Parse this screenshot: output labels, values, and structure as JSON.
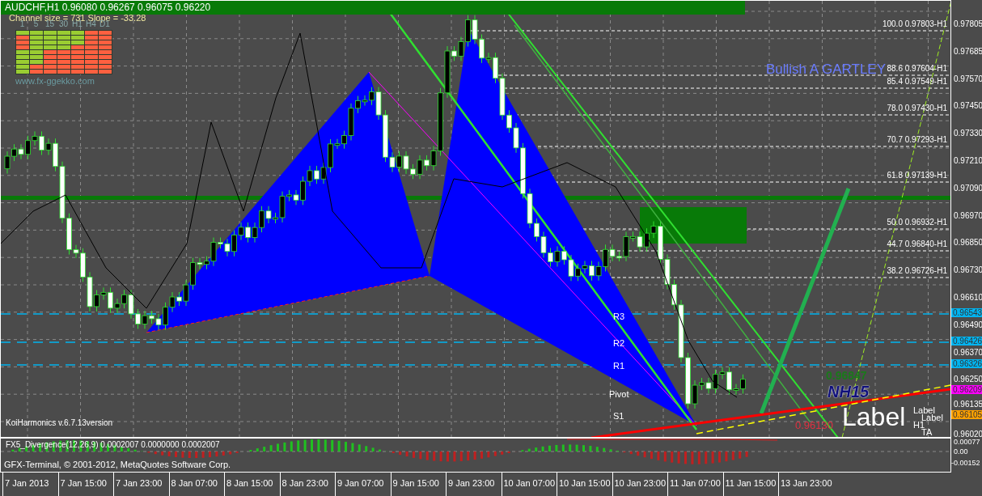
{
  "chart": {
    "header": "AUDCHF,H1  0.96080 0.96267 0.96075 0.96220",
    "channel_info": "Channel size = 731 Slope = -33.28",
    "timeframe_panel": {
      "columns": [
        {
          "label": "1",
          "cells": [
            {
              "color": "#9acd32"
            },
            {
              "color": "#ff6040"
            },
            {
              "color": "#ff6040"
            },
            {
              "color": "#ff6040"
            },
            {
              "color": "#9acd32"
            },
            {
              "color": "#9acd32"
            },
            {
              "color": "#9acd32"
            },
            {
              "color": "#9acd32"
            },
            {
              "color": "#9acd32"
            }
          ]
        },
        {
          "label": "5",
          "cells": [
            {
              "color": "#9acd32"
            },
            {
              "color": "#9acd32"
            },
            {
              "color": "#9acd32"
            },
            {
              "color": "#9acd32"
            },
            {
              "color": "#9acd32"
            },
            {
              "color": "#9acd32"
            },
            {
              "color": "#9acd32"
            },
            {
              "color": "#ff6040"
            },
            {
              "color": "#ff6040"
            }
          ]
        },
        {
          "label": "15",
          "cells": [
            {
              "color": "#9acd32"
            },
            {
              "color": "#9acd32"
            },
            {
              "color": "#9acd32"
            },
            {
              "color": "#9acd32"
            },
            {
              "color": "#ff6040"
            },
            {
              "color": "#ff6040"
            },
            {
              "color": "#ff6040"
            },
            {
              "color": "#ff6040"
            },
            {
              "color": "#ff6040"
            }
          ]
        },
        {
          "label": "30",
          "cells": [
            {
              "color": "#9acd32"
            },
            {
              "color": "#9acd32"
            },
            {
              "color": "#9acd32"
            },
            {
              "color": "#9acd32"
            },
            {
              "color": "#ff6040"
            },
            {
              "color": "#ff6040"
            },
            {
              "color": "#ff6040"
            },
            {
              "color": "#ff6040"
            },
            {
              "color": "#ff6040"
            }
          ]
        },
        {
          "label": "H1",
          "cells": [
            {
              "color": "#9acd32"
            },
            {
              "color": "#9acd32"
            },
            {
              "color": "#9acd32"
            },
            {
              "color": "#ff6040"
            },
            {
              "color": "#ff6040"
            },
            {
              "color": "#ff6040"
            },
            {
              "color": "#ff6040"
            },
            {
              "color": "#ff6040"
            },
            {
              "color": "#ff6040"
            }
          ]
        },
        {
          "label": "H4",
          "cells": [
            {
              "color": "#ff6040"
            },
            {
              "color": "#ff6040"
            },
            {
              "color": "#ff6040"
            },
            {
              "color": "#ff6040"
            },
            {
              "color": "#ff6040"
            },
            {
              "color": "#ff6040"
            },
            {
              "color": "#ff6040"
            },
            {
              "color": "#ff6040"
            },
            {
              "color": "#ff6040"
            }
          ]
        },
        {
          "label": "D1",
          "cells": [
            {
              "color": "#ff6040"
            },
            {
              "color": "#ff6040"
            },
            {
              "color": "#ff6040"
            },
            {
              "color": "#ff6040"
            },
            {
              "color": "#ff6040"
            },
            {
              "color": "#ff6040"
            },
            {
              "color": "#ff6040"
            },
            {
              "color": "#ff6040"
            },
            {
              "color": "#ff6040"
            }
          ]
        }
      ],
      "website": "www.fx-ggekko.com"
    },
    "pattern_label": "Bullish A GARTLEY",
    "fib_levels": [
      "100.0 0.97803-H1",
      "88.6 0.97604-H1",
      "85.4 0.97549-H1",
      "78.0 0.97430-H1",
      "70.7 0.97293-H1",
      "61.8 0.97139-H1",
      "50.0 0.96932-H1",
      "44.7 0.96840-H1",
      "38.2 0.96726-H1"
    ],
    "pivot_labels": [
      "R3",
      "R2",
      "R1",
      "Pivot",
      "S1"
    ],
    "indicator_name": "KoiHarmonics v.6.7.13version",
    "marks": [
      {
        "text": "0.96847",
        "kind": "price"
      },
      {
        "text": "NH15",
        "kind": "tag"
      },
      {
        "text": "0.96130",
        "kind": "alert"
      },
      {
        "text": "Label",
        "kind": "big"
      },
      {
        "text": "Label",
        "kind": "small"
      },
      {
        "text": "Label",
        "kind": "small"
      },
      {
        "text": "H1",
        "kind": "small"
      },
      {
        "text": "TA",
        "kind": "small"
      }
    ],
    "price_axis": [
      "0.97805",
      "0.97685",
      "0.97570",
      "0.97450",
      "0.97330",
      "0.97210",
      "0.97090",
      "0.96970",
      "0.96850",
      "0.96730",
      "0.96610",
      "0.96490",
      "0.96370",
      "0.96250",
      "0.96135",
      "0.96020"
    ],
    "price_markers": [
      {
        "text": "0.96543",
        "color": "#00b4f0"
      },
      {
        "text": "0.96426",
        "color": "#00b4f0"
      },
      {
        "text": "0.96326",
        "color": "#00b4f0"
      },
      {
        "text": "0.96209",
        "color": "#ff00ff"
      },
      {
        "text": "0.96105",
        "color": "#ffa000"
      }
    ]
  },
  "oscillator": {
    "title": "FX5_Divergence(12,26,9) 0.0002007 0.0000000 0.0002007",
    "axis": [
      "0.00077",
      "0.00",
      "-0.00152"
    ],
    "copyright": "GFX-Terminal, © 2001-2012, MetaQuotes Software Corp."
  },
  "time_axis": [
    "7 Jan 2013",
    "7 Jan 15:00",
    "7 Jan 23:00",
    "8 Jan 07:00",
    "8 Jan 15:00",
    "8 Jan 23:00",
    "9 Jan 07:00",
    "9 Jan 15:00",
    "9 Jan 23:00",
    "10 Jan 07:00",
    "10 Jan 15:00",
    "10 Jan 23:00",
    "11 Jan 07:00",
    "11 Jan 15:00",
    "13 Jan 23:00"
  ]
}
